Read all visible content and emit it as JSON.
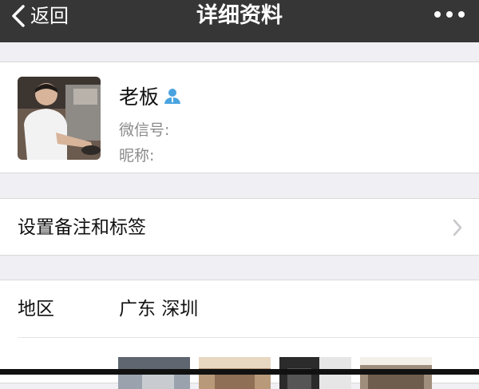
{
  "nav": {
    "back_label": "返回",
    "title": "详细资料"
  },
  "profile": {
    "name": "老板",
    "wechat_id_label": "微信号:",
    "nickname_label": "昵称:"
  },
  "remark": {
    "label": "设置备注和标签"
  },
  "info": {
    "region_label": "地区",
    "region_value": "广东 深圳"
  },
  "colors": {
    "navbar": "#363636",
    "background": "#efeff4",
    "contact_icon": "#4aa3df"
  }
}
